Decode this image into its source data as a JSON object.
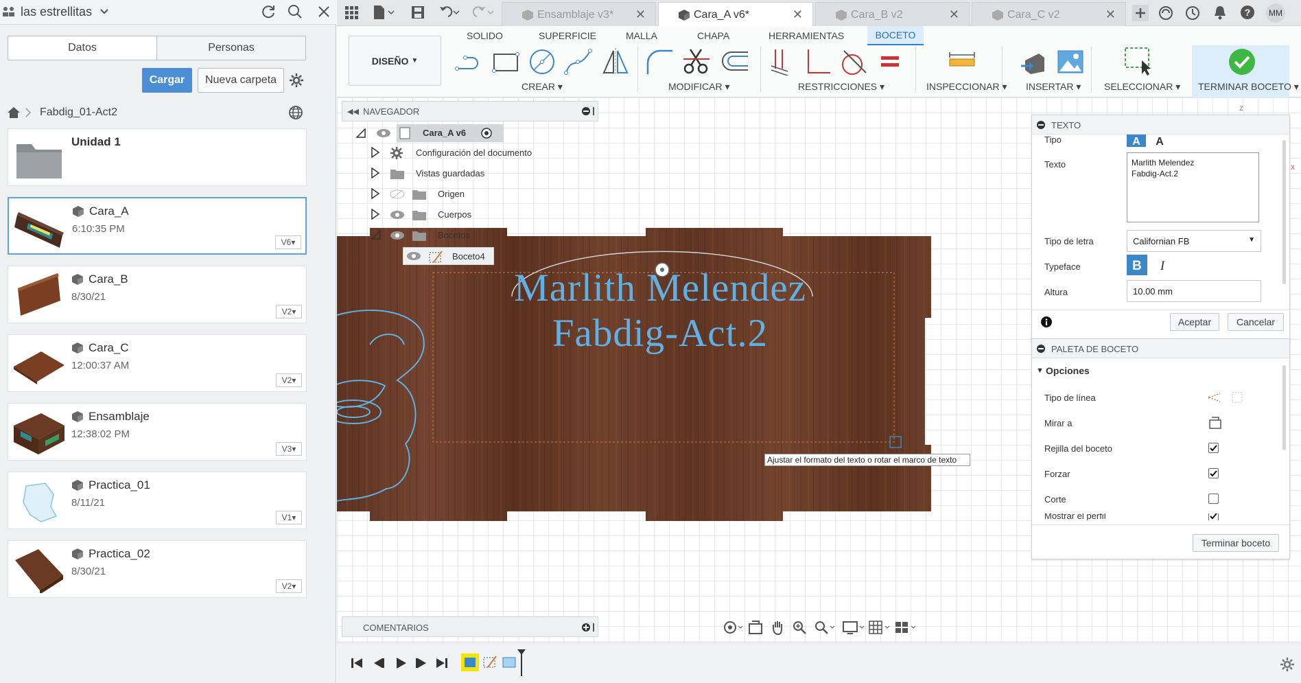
{
  "left_panel": {
    "project_name": "las estrellitas",
    "tabs": [
      "Datos",
      "Personas"
    ],
    "upload_label": "Cargar",
    "new_folder_label": "Nueva carpeta",
    "breadcrumb": "Fabdig_01-Act2",
    "items": [
      {
        "title": "Unidad 1",
        "sub": "",
        "version": ""
      },
      {
        "title": "Cara_A",
        "sub": "6:10:35 PM",
        "version": "V6"
      },
      {
        "title": "Cara_B",
        "sub": "8/30/21",
        "version": "V2"
      },
      {
        "title": "Cara_C",
        "sub": "12:00:37 AM",
        "version": "V2"
      },
      {
        "title": "Ensamblaje",
        "sub": "12:38:02 PM",
        "version": "V3"
      },
      {
        "title": "Practica_01",
        "sub": "8/11/21",
        "version": "V1"
      },
      {
        "title": "Practica_02",
        "sub": "8/30/21",
        "version": "V2"
      }
    ]
  },
  "doc_tabs": [
    {
      "label": "Ensamblaje v3*"
    },
    {
      "label": "Cara_A v6*"
    },
    {
      "label": "Cara_B v2"
    },
    {
      "label": "Cara_C v2"
    }
  ],
  "user_initials": "MM",
  "ribbon": {
    "tabs": [
      "SOLIDO",
      "SUPERFICIE",
      "MALLA",
      "CHAPA",
      "HERRAMIENTAS",
      "BOCETO"
    ],
    "workspace": "DISEÑO",
    "groups": [
      "CREAR",
      "MODIFICAR",
      "RESTRICCIONES",
      "INSPECCIONAR",
      "INSERTAR",
      "SELECCIONAR",
      "TERMINAR BOCETO"
    ]
  },
  "navigator": {
    "title": "NAVEGADOR",
    "root": "Cara_A v6",
    "items": [
      "Configuración del documento",
      "Vistas guardadas",
      "Origen",
      "Cuerpos",
      "Bocetos",
      "Boceto4"
    ]
  },
  "sketch_text": {
    "line1": "Marlith Melendez",
    "line2": "Fabdig-Act.2"
  },
  "tooltip": "Ajustar el formato del texto o rotar el marco de texto",
  "text_panel": {
    "title": "TEXTO",
    "tipo_label": "Tipo",
    "texto_label": "Texto",
    "texto_value": "Marlith Melendez\nFabdig-Act.2",
    "font_label": "Tipo de letra",
    "font_value": "Californian FB",
    "typeface_label": "Typeface",
    "altura_label": "Altura",
    "altura_value": "10.00 mm",
    "ok_label": "Aceptar",
    "cancel_label": "Cancelar"
  },
  "palette": {
    "title": "PALETA DE BOCETO",
    "section": "Opciones",
    "options": [
      {
        "label": "Tipo de línea"
      },
      {
        "label": "Mirar a"
      },
      {
        "label": "Rejilla del boceto",
        "checked": true
      },
      {
        "label": "Forzar",
        "checked": true
      },
      {
        "label": "Corte",
        "checked": false
      },
      {
        "label": "Mostrar el perfil",
        "checked": true
      }
    ],
    "finish_label": "Terminar boceto"
  },
  "comments_label": "COMENTARIOS",
  "colors": {
    "accent": "#2f7fd1",
    "upload_btn": "#4a8fd6",
    "sketch_text": "#5eb0e5",
    "wood": "#6b3a22",
    "finish_bg": "#dceefb"
  }
}
